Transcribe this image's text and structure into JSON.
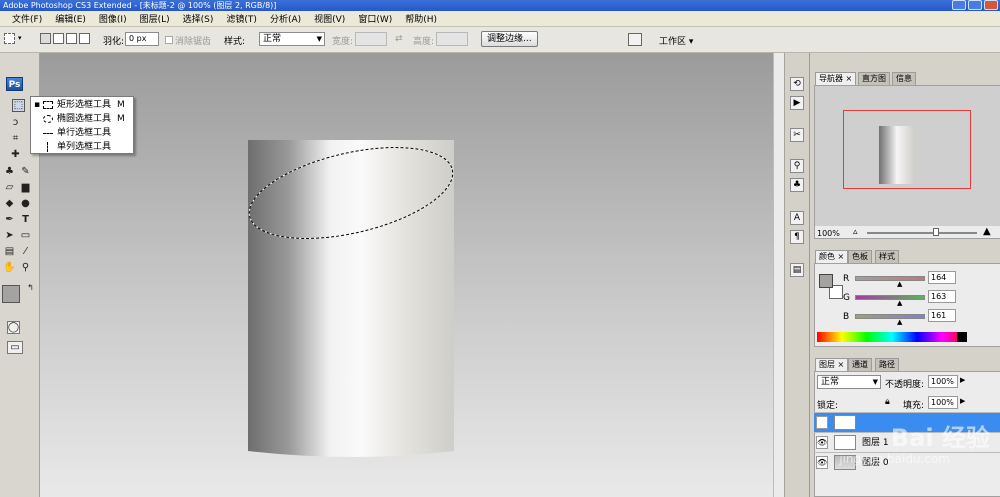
{
  "window": {
    "title": "Adobe Photoshop CS3 Extended - [未标题-2 @ 100% (图层 2, RGB/8)]"
  },
  "menu": [
    "文件(F)",
    "编辑(E)",
    "图像(I)",
    "图层(L)",
    "选择(S)",
    "滤镜(T)",
    "分析(A)",
    "视图(V)",
    "窗口(W)",
    "帮助(H)"
  ],
  "options": {
    "feather_label": "羽化:",
    "feather_value": "0 px",
    "antialias_label": "消除锯齿",
    "style_label": "样式:",
    "style_value": "正常",
    "width_label": "宽度:",
    "height_label": "高度:",
    "refine_button": "调整边缘...",
    "workspace_label": "工作区"
  },
  "toolbox": {
    "badge": "Ps"
  },
  "flyout": {
    "items": [
      {
        "label": "矩形选框工具",
        "shortcut": "M",
        "selected": true
      },
      {
        "label": "椭圆选框工具",
        "shortcut": "M",
        "selected": false
      },
      {
        "label": "单行选框工具",
        "shortcut": "",
        "selected": false
      },
      {
        "label": "单列选框工具",
        "shortcut": "",
        "selected": false
      }
    ]
  },
  "navigator": {
    "tabs": [
      "导航器",
      "直方图",
      "信息"
    ],
    "zoom": "100%"
  },
  "color": {
    "tabs": [
      "颜色",
      "色板",
      "样式"
    ],
    "channels": [
      {
        "name": "R",
        "value": "164",
        "color": "#c07878"
      },
      {
        "name": "G",
        "value": "163",
        "color": "#78a878"
      },
      {
        "name": "B",
        "value": "161",
        "color": "#7878c0"
      }
    ],
    "foreground": "#a4a3a1"
  },
  "layers": {
    "tabs": [
      "图层",
      "通道",
      "路径"
    ],
    "blend_mode": "正常",
    "opacity_label": "不透明度:",
    "opacity_value": "100%",
    "lock_label": "锁定:",
    "fill_label": "填充:",
    "fill_value": "100%",
    "items": [
      {
        "name": "",
        "selected": true
      },
      {
        "name": "图层 1",
        "selected": false
      },
      {
        "name": "图层 0",
        "selected": false
      }
    ]
  },
  "watermark": {
    "text": "Bai 经验",
    "url": "jingyan.baidu.com"
  }
}
